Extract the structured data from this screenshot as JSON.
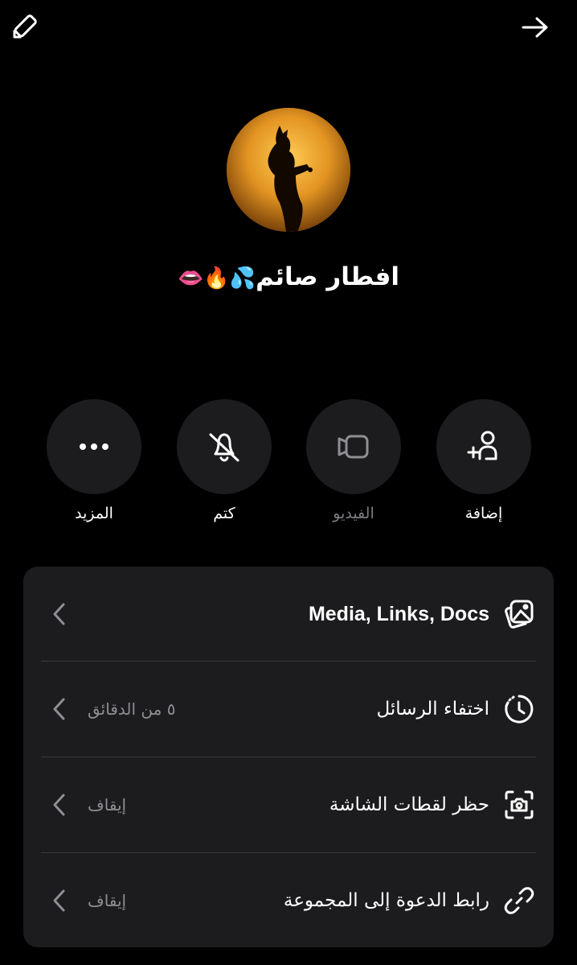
{
  "header": {
    "edit_icon": "pencil-icon",
    "back_icon": "arrow-right-icon"
  },
  "profile": {
    "name": "افطار صائم",
    "name_emoji": "💦🔥👄",
    "subtitle": "",
    "avatar_colors": [
      "#f5b13b",
      "#e0921f",
      "#a8620f"
    ]
  },
  "actions": [
    {
      "label": "إضافة",
      "icon": "add-person-icon",
      "enabled": true
    },
    {
      "label": "الفيديو",
      "icon": "video-camera-icon",
      "enabled": false
    },
    {
      "label": "كتم",
      "icon": "bell-slash-icon",
      "enabled": true
    },
    {
      "label": "المزيد",
      "icon": "more-dots-icon",
      "enabled": true
    }
  ],
  "settings": [
    {
      "label": "Media, Links, Docs",
      "value": "",
      "icon": "media-gallery-icon"
    },
    {
      "label": "اختفاء الرسائل",
      "value": "٥ من الدقائق",
      "icon": "timer-icon"
    },
    {
      "label": "حظر لقطات الشاشة",
      "value": "إيقاف",
      "icon": "screenshot-block-icon"
    },
    {
      "label": "رابط الدعوة إلى المجموعة",
      "value": "إيقاف",
      "icon": "link-icon"
    }
  ],
  "colors": {
    "background": "#000000",
    "surface": "#1c1c1e",
    "text_primary": "#ffffff",
    "text_secondary": "#8e8e93",
    "divider": "#3a3a3c"
  }
}
